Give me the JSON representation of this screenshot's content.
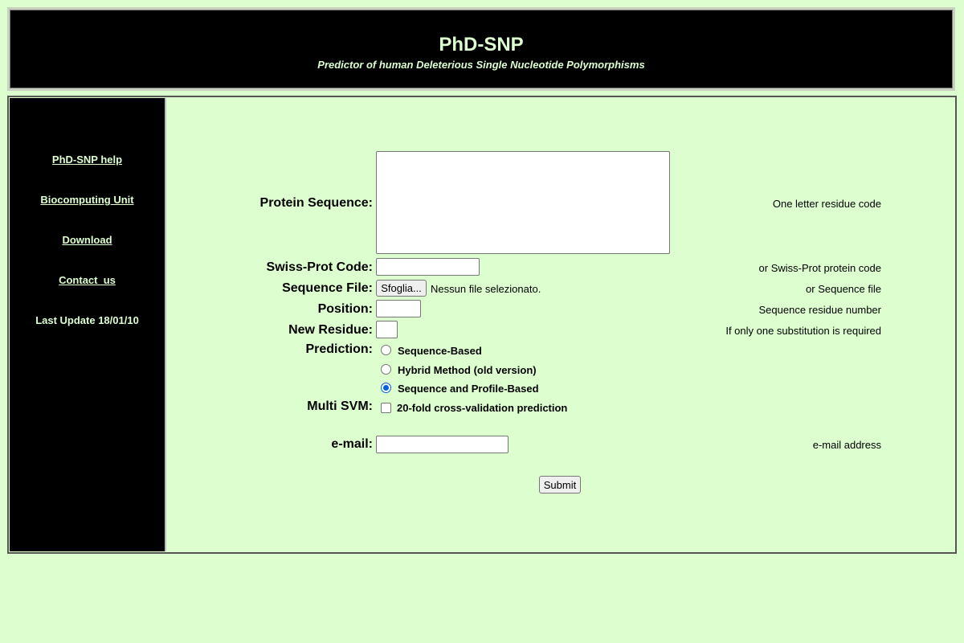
{
  "header": {
    "title": "PhD-SNP",
    "subtitle": "Predictor of human Deleterious Single Nucleotide Polymorphisms"
  },
  "sidebar": {
    "links": [
      "PhD-SNP help",
      "Biocomputing Unit",
      "Download",
      "Contact  us"
    ],
    "last_update": "Last Update 18/01/10"
  },
  "form": {
    "protein_sequence": {
      "label": "Protein Sequence:",
      "hint": "One letter residue code",
      "value": ""
    },
    "swissprot_code": {
      "label": "Swiss-Prot Code:",
      "hint": "or Swiss-Prot protein code",
      "value": ""
    },
    "sequence_file": {
      "label": "Sequence File:",
      "hint": "or Sequence file",
      "button_label": "Sfoglia...",
      "status": "Nessun file selezionato."
    },
    "position": {
      "label": "Position:",
      "hint": "Sequence residue number",
      "value": ""
    },
    "new_residue": {
      "label": "New Residue:",
      "hint": "If only one substitution is required",
      "value": ""
    },
    "prediction": {
      "label": "Prediction:",
      "options": [
        "Sequence-Based",
        "Hybrid Method (old version)",
        "Sequence and Profile-Based"
      ],
      "selected": "Sequence and Profile-Based"
    },
    "multi_svm": {
      "label": "Multi SVM:",
      "option": "20-fold cross-validation prediction",
      "checked": false
    },
    "email": {
      "label": "e-mail:",
      "hint": "e-mail address",
      "value": ""
    },
    "submit_label": "Submit"
  },
  "colors": {
    "background": "#ddffd0",
    "header_bg": "#000000",
    "accent_text": "#ddffd0",
    "radio_selected": "#0060df"
  }
}
